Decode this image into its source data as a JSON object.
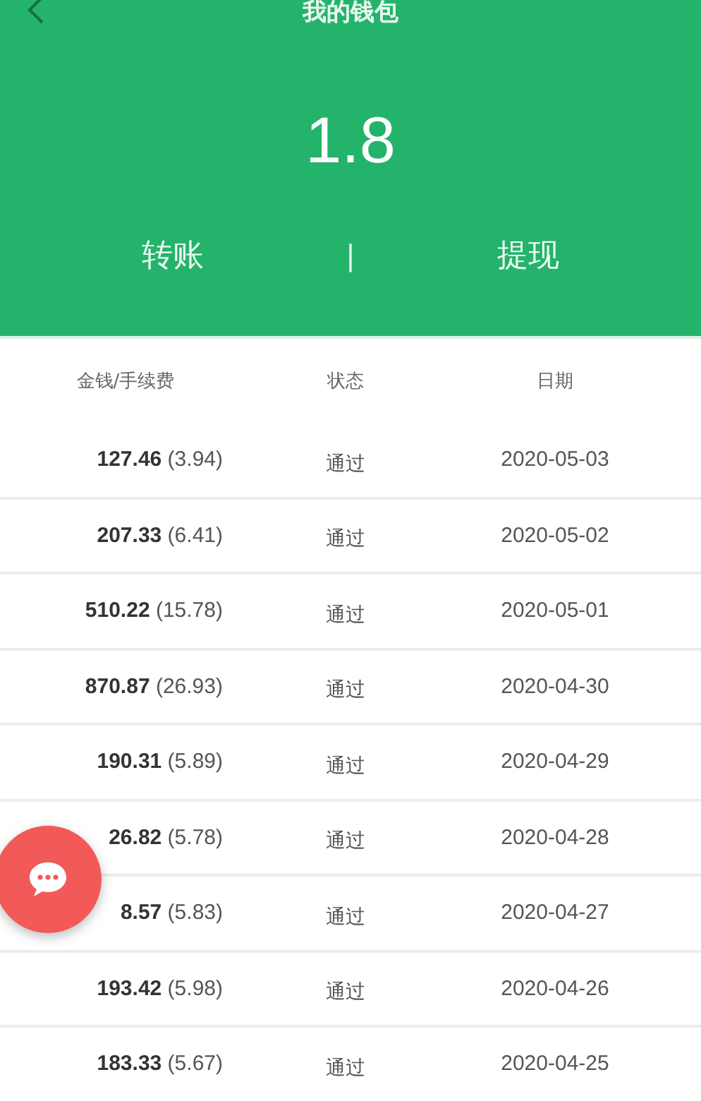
{
  "header": {
    "title": "我的钱包",
    "balance": "1.8",
    "actions": [
      "转账",
      "提现"
    ],
    "separator": "|"
  },
  "table": {
    "columns": [
      "金钱/手续费",
      "状态",
      "日期"
    ],
    "rows": [
      {
        "amount": "**127.46** (3.94)",
        "status": "通过",
        "date": "2020-05-03"
      },
      {
        "amount": "**207.33** (6.41)",
        "status": "通过",
        "date": "2020-05-02"
      },
      {
        "amount": "**510.22** (15.78)",
        "status": "通过",
        "date": "2020-05-01"
      },
      {
        "amount": "**870.87** (26.93)",
        "status": "通过",
        "date": "2020-04-30"
      },
      {
        "amount": "**190.31** (5.89)",
        "status": "通过",
        "date": "2020-04-29"
      },
      {
        "amount": "**26.82** (5.78)",
        "status": "通过",
        "date": "2020-04-28"
      },
      {
        "amount": "**8.57** (5.83)",
        "status": "通过",
        "date": "2020-04-27"
      },
      {
        "amount": "**193.42** (5.98)",
        "status": "通过",
        "date": "2020-04-26"
      },
      {
        "amount": "**183.33** (5.67)",
        "status": "通过",
        "date": "2020-04-25"
      }
    ]
  }
}
